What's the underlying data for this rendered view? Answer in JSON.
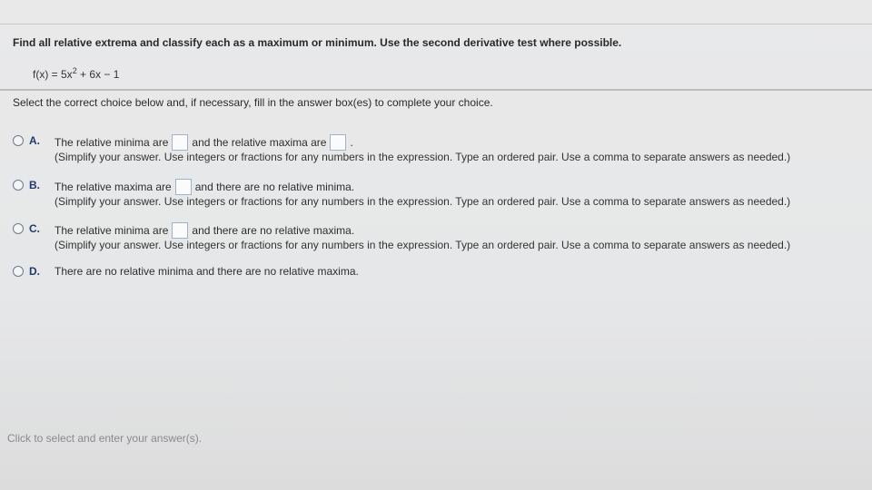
{
  "question": {
    "prompt": "Find all relative extrema and classify each as a maximum or minimum. Use the second derivative test where possible.",
    "function_lhs": "f(x) = 5x",
    "function_exp": "2",
    "function_rhs": " + 6x − 1"
  },
  "instruction": "Select the correct choice below and, if necessary, fill in the answer box(es) to complete your choice.",
  "choices": [
    {
      "letter": "A.",
      "text_before": "The relative minima are",
      "text_middle": "and the relative maxima are",
      "text_after": ".",
      "hint": "(Simplify your answer. Use integers or fractions for any numbers in the expression. Type an ordered pair. Use a comma to separate answers as needed.)"
    },
    {
      "letter": "B.",
      "text_before": "The relative maxima are",
      "text_after": "and there are no relative minima.",
      "hint": "(Simplify your answer. Use integers or fractions for any numbers in the expression. Type an ordered pair. Use a comma to separate answers as needed.)"
    },
    {
      "letter": "C.",
      "text_before": "The relative minima are",
      "text_after": "and there are no relative maxima.",
      "hint": "(Simplify your answer. Use integers or fractions for any numbers in the expression. Type an ordered pair. Use a comma to separate answers as needed.)"
    },
    {
      "letter": "D.",
      "text_before": "There are no relative minima and there are no relative maxima."
    }
  ],
  "footer": "Click to select and enter your answer(s).",
  "colors": {
    "accent": "#1f3b6e",
    "box_border": "#9fb2c9"
  }
}
